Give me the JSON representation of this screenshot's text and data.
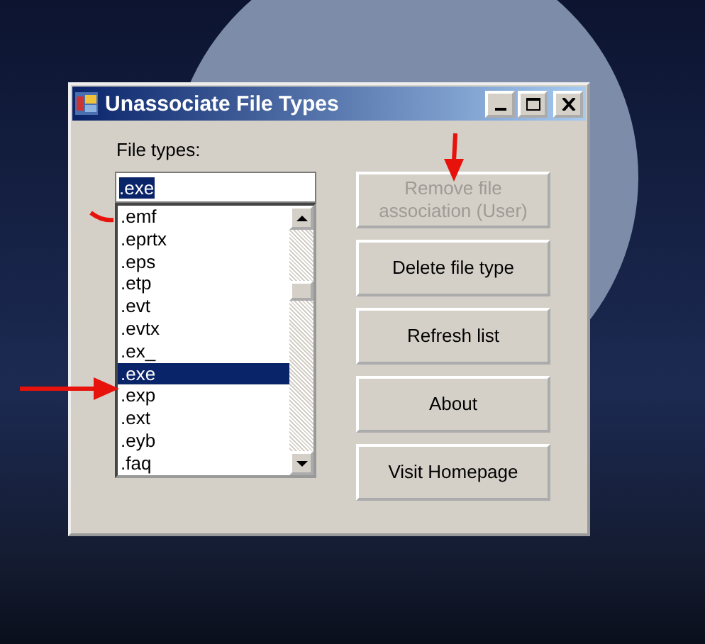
{
  "window": {
    "title": "Unassociate File Types"
  },
  "file_types_label": "File types:",
  "search": {
    "value": ".exe"
  },
  "list": [
    {
      "label": ".emf",
      "selected": false
    },
    {
      "label": ".eprtx",
      "selected": false
    },
    {
      "label": ".eps",
      "selected": false
    },
    {
      "label": ".etp",
      "selected": false
    },
    {
      "label": ".evt",
      "selected": false
    },
    {
      "label": ".evtx",
      "selected": false
    },
    {
      "label": ".ex_",
      "selected": false
    },
    {
      "label": ".exe",
      "selected": true
    },
    {
      "label": ".exp",
      "selected": false
    },
    {
      "label": ".ext",
      "selected": false
    },
    {
      "label": ".eyb",
      "selected": false
    },
    {
      "label": ".faq",
      "selected": false
    }
  ],
  "buttons": [
    {
      "label": "Remove file association (User)",
      "disabled": true
    },
    {
      "label": "Delete file type",
      "disabled": false
    },
    {
      "label": "Refresh list",
      "disabled": false
    },
    {
      "label": "About",
      "disabled": false
    },
    {
      "label": "Visit Homepage",
      "disabled": false
    }
  ]
}
